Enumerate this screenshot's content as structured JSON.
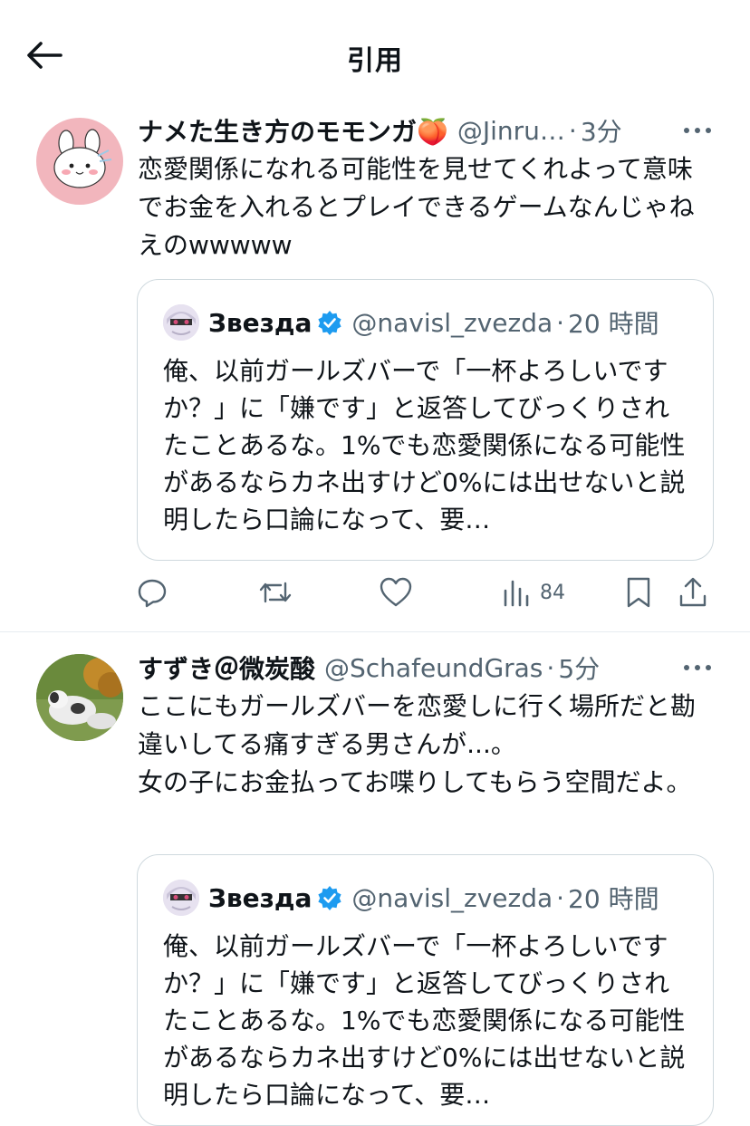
{
  "header": {
    "title": "引用"
  },
  "tweets": [
    {
      "name": "ナメた生き方のモモンガ🍑",
      "handle": "@Jinru…",
      "dot": "·",
      "time": "3分",
      "text": "恋愛関係になれる可能性を見せてくれよって意味でお金を入れるとプレイできるゲームなんじゃねえのwwwww",
      "quote": {
        "name": "Звезда",
        "handle": "@navisl_zvezda",
        "dot": "·",
        "time": "20 時間",
        "text": "俺、以前ガールズバーで「一杯よろしいですか？」に「嫌です」と返答してびっくりされたことあるな。1%でも恋愛関係になる可能性があるならカネ出すけど0%には出せないと説明したら口論になって、要…"
      },
      "views": "84"
    },
    {
      "name": "すずき＠微炭酸",
      "handle": "@SchafeundGras",
      "dot": "·",
      "time": "5分",
      "text": "ここにもガールズバーを恋愛しに行く場所だと勘違いしてる痛すぎる男さんが...。\n女の子にお金払ってお喋りしてもらう空間だよ。",
      "quote": {
        "name": "Звезда",
        "handle": "@navisl_zvezda",
        "dot": "·",
        "time": "20 時間",
        "text": "俺、以前ガールズバーで「一杯よろしいですか？」に「嫌です」と返答してびっくりされたことあるな。1%でも恋愛関係になる可能性があるならカネ出すけど0%には出せないと説明したら口論になって、要…"
      }
    }
  ],
  "colors": {
    "text": "#0f1419",
    "secondary": "#536471",
    "verified": "#1d9bf0",
    "border": "#cfd9de"
  }
}
